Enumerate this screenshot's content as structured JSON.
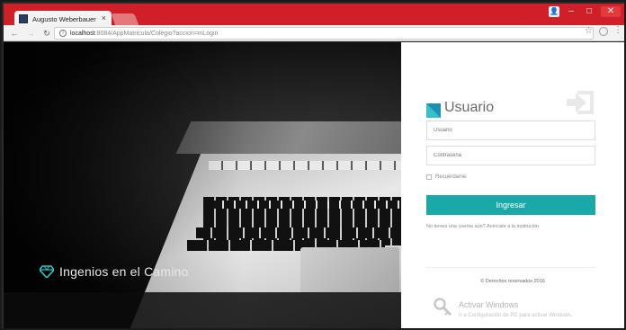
{
  "browser": {
    "tab_title": "Augusto Weberbauer",
    "tab_close": "×",
    "url_host": "localhost",
    "url_path": ":8084/AppMatricula/Colegio?accion=inLogin"
  },
  "hero": {
    "brand": "Ingenios en el Camino"
  },
  "login": {
    "title": "Usuario",
    "username_placeholder": "Usuario",
    "password_placeholder": "Contraseña",
    "remember_label": "Recuérdame",
    "submit_label": "Ingresar",
    "signup_text": "No tienes una cuenta aún? Acércate a la institución.",
    "copyright": "© Derechos reservados 2016"
  },
  "watermark": {
    "title": "Activar Windows",
    "subtitle": "Ir a Configuración de PC para activar Windows."
  },
  "colors": {
    "chrome_red": "#cf1f28",
    "accent_teal": "#1aa8a8"
  },
  "icons": [
    "favicon",
    "back-icon",
    "forward-icon",
    "reload-icon",
    "info-icon",
    "star-icon",
    "extension-icon",
    "menu-icon",
    "diamond-icon",
    "usuario-logo-icon",
    "sign-in-icon",
    "key-icon"
  ]
}
